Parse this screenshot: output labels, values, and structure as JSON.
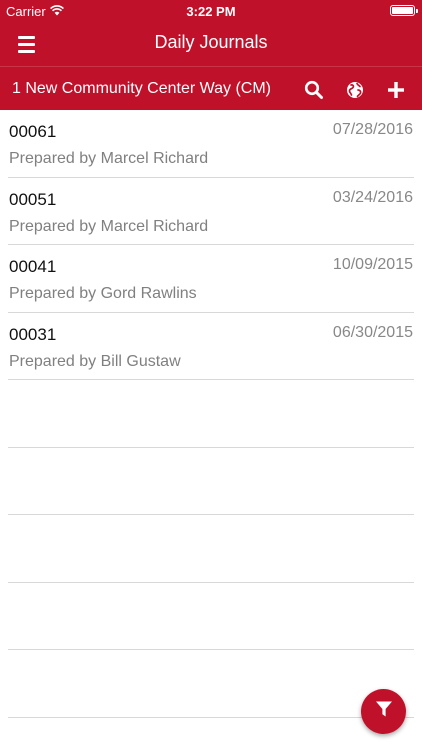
{
  "status_bar": {
    "carrier": "Carrier",
    "time": "3:22 PM"
  },
  "nav": {
    "title": "Daily Journals"
  },
  "project": {
    "title": "1 New Community Center Way (CM)"
  },
  "journals": [
    {
      "number": "00061",
      "date": "07/28/2016",
      "prepared_by": "Prepared by Marcel Richard"
    },
    {
      "number": "00051",
      "date": "03/24/2016",
      "prepared_by": "Prepared by Marcel Richard"
    },
    {
      "number": "00041",
      "date": "10/09/2015",
      "prepared_by": "Prepared by Gord Rawlins"
    },
    {
      "number": "00031",
      "date": "06/30/2015",
      "prepared_by": "Prepared by Bill Gustaw"
    }
  ],
  "colors": {
    "brand_red": "#c0112b",
    "divider": "#d8d8d8",
    "secondary_text": "#808080"
  },
  "icons": [
    "wifi-icon",
    "battery-icon",
    "hamburger-menu-icon",
    "search-icon",
    "globe-icon",
    "plus-icon",
    "filter-icon"
  ]
}
